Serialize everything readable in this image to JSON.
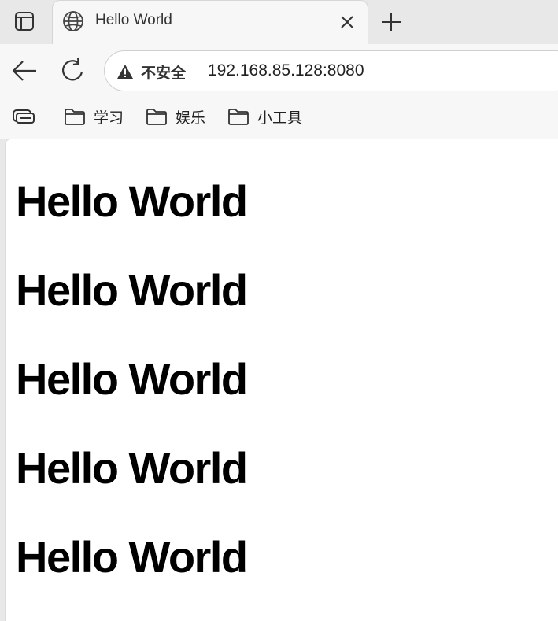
{
  "tab": {
    "title": "Hello World"
  },
  "address_bar": {
    "security_label": "不安全",
    "url": "192.168.85.128:8080"
  },
  "bookmarks": [
    {
      "label": "学习"
    },
    {
      "label": "娱乐"
    },
    {
      "label": "小工具"
    }
  ],
  "content": {
    "headings": [
      "Hello World",
      "Hello World",
      "Hello World",
      "Hello World",
      "Hello World"
    ]
  },
  "icons": {
    "tab_actions": "tab-actions-icon",
    "favicon": "globe-icon",
    "close": "close-icon",
    "new_tab": "plus-icon",
    "back": "back-arrow-icon",
    "reload": "reload-icon",
    "security": "warning-icon",
    "collections": "collections-icon",
    "folder": "folder-icon"
  }
}
